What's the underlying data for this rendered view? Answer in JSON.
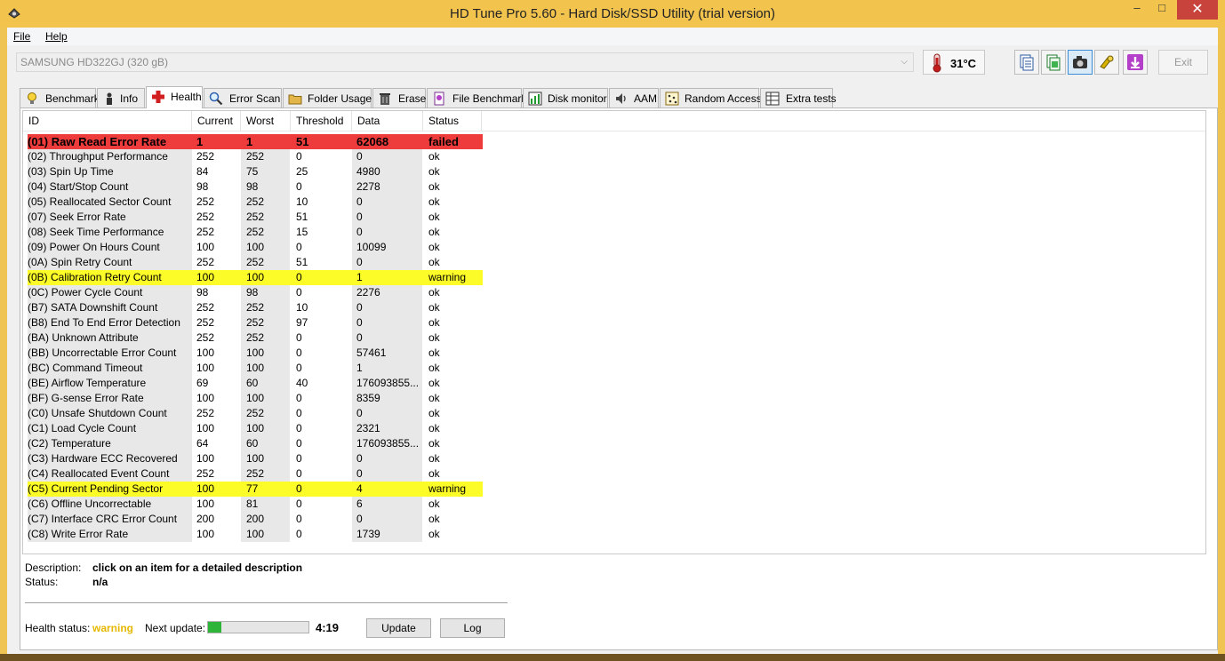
{
  "window": {
    "title": "HD Tune Pro 5.60 - Hard Disk/SSD Utility (trial version)",
    "minimize": "–",
    "maximize": "□",
    "close": "✕"
  },
  "menu": {
    "file": "File",
    "help": "Help"
  },
  "toolbar": {
    "drive": "SAMSUNG HD322GJ (320 gB)",
    "temperature": "31°C",
    "exit": "Exit",
    "icons": [
      "copy-text-icon",
      "copy-screenshot-icon",
      "camera-icon",
      "options-icon",
      "save-down-icon"
    ]
  },
  "tabs": [
    "Benchmark",
    "Info",
    "Health",
    "Error Scan",
    "Folder Usage",
    "Erase",
    "File Benchmark",
    "Disk monitor",
    "AAM",
    "Random Access",
    "Extra tests"
  ],
  "active_tab": "Health",
  "columns": [
    "ID",
    "Current",
    "Worst",
    "Threshold",
    "Data",
    "Status"
  ],
  "rows": [
    [
      "(01) Raw Read Error Rate",
      "1",
      "1",
      "51",
      "62068",
      "failed"
    ],
    [
      "(02) Throughput Performance",
      "252",
      "252",
      "0",
      "0",
      "ok"
    ],
    [
      "(03) Spin Up Time",
      "84",
      "75",
      "25",
      "4980",
      "ok"
    ],
    [
      "(04) Start/Stop Count",
      "98",
      "98",
      "0",
      "2278",
      "ok"
    ],
    [
      "(05) Reallocated Sector Count",
      "252",
      "252",
      "10",
      "0",
      "ok"
    ],
    [
      "(07) Seek Error Rate",
      "252",
      "252",
      "51",
      "0",
      "ok"
    ],
    [
      "(08) Seek Time Performance",
      "252",
      "252",
      "15",
      "0",
      "ok"
    ],
    [
      "(09) Power On Hours Count",
      "100",
      "100",
      "0",
      "10099",
      "ok"
    ],
    [
      "(0A) Spin Retry Count",
      "252",
      "252",
      "51",
      "0",
      "ok"
    ],
    [
      "(0B) Calibration Retry Count",
      "100",
      "100",
      "0",
      "1",
      "warning"
    ],
    [
      "(0C) Power Cycle Count",
      "98",
      "98",
      "0",
      "2276",
      "ok"
    ],
    [
      "(B7) SATA Downshift Count",
      "252",
      "252",
      "10",
      "0",
      "ok"
    ],
    [
      "(B8) End To End Error Detection",
      "252",
      "252",
      "97",
      "0",
      "ok"
    ],
    [
      "(BA) Unknown Attribute",
      "252",
      "252",
      "0",
      "0",
      "ok"
    ],
    [
      "(BB) Uncorrectable Error Count",
      "100",
      "100",
      "0",
      "57461",
      "ok"
    ],
    [
      "(BC) Command Timeout",
      "100",
      "100",
      "0",
      "1",
      "ok"
    ],
    [
      "(BE) Airflow Temperature",
      "69",
      "60",
      "40",
      "176093855...",
      "ok"
    ],
    [
      "(BF) G-sense Error Rate",
      "100",
      "100",
      "0",
      "8359",
      "ok"
    ],
    [
      "(C0) Unsafe Shutdown Count",
      "252",
      "252",
      "0",
      "0",
      "ok"
    ],
    [
      "(C1) Load Cycle Count",
      "100",
      "100",
      "0",
      "2321",
      "ok"
    ],
    [
      "(C2) Temperature",
      "64",
      "60",
      "0",
      "176093855...",
      "ok"
    ],
    [
      "(C3) Hardware ECC Recovered",
      "100",
      "100",
      "0",
      "0",
      "ok"
    ],
    [
      "(C4) Reallocated Event Count",
      "252",
      "252",
      "0",
      "0",
      "ok"
    ],
    [
      "(C5) Current Pending Sector",
      "100",
      "77",
      "0",
      "4",
      "warning"
    ],
    [
      "(C6) Offline Uncorrectable",
      "100",
      "81",
      "0",
      "6",
      "ok"
    ],
    [
      "(C7) Interface CRC Error Count",
      "200",
      "200",
      "0",
      "0",
      "ok"
    ],
    [
      "(C8) Write Error Rate",
      "100",
      "100",
      "0",
      "1739",
      "ok"
    ]
  ],
  "description": {
    "label": "Description:",
    "value": "click on an item for a detailed description",
    "status_label": "Status:",
    "status_value": "n/a"
  },
  "footer": {
    "health_label": "Health status:",
    "health_value": "warning",
    "next_update_label": "Next update:",
    "next_update_progress": 0.13,
    "countdown": "4:19",
    "update_button": "Update",
    "log_button": "Log"
  },
  "colors": {
    "failed": "#ee3b3b",
    "warning": "#fcfc28",
    "title_bar": "#f2c44e",
    "progress": "#2fb43a"
  }
}
